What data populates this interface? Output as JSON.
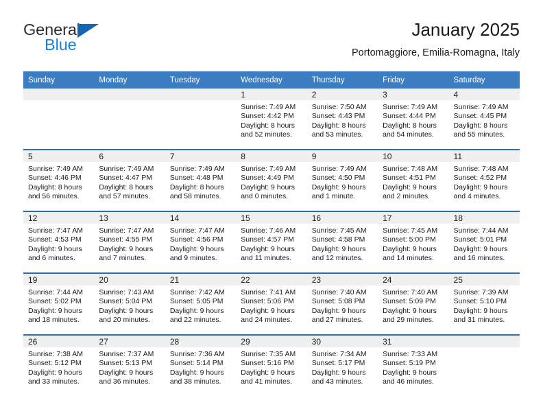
{
  "brand": {
    "line1": "General",
    "line2": "Blue",
    "triangle_color": "#1565b0",
    "blue_text_color": "#1a7fd4"
  },
  "header": {
    "title": "January 2025",
    "subtitle": "Portomaggiore, Emilia-Romagna, Italy"
  },
  "theme": {
    "header_row_bg": "#3b7dc0",
    "row_border": "#2f6cb0",
    "daynum_band_bg": "#efefef",
    "text": "#1a1a1a"
  },
  "calendar": {
    "weekday_headers": [
      "Sunday",
      "Monday",
      "Tuesday",
      "Wednesday",
      "Thursday",
      "Friday",
      "Saturday"
    ],
    "weeks": [
      [
        {
          "day": "",
          "sunrise": "",
          "sunset": "",
          "daylight1": "",
          "daylight2": ""
        },
        {
          "day": "",
          "sunrise": "",
          "sunset": "",
          "daylight1": "",
          "daylight2": ""
        },
        {
          "day": "",
          "sunrise": "",
          "sunset": "",
          "daylight1": "",
          "daylight2": ""
        },
        {
          "day": "1",
          "sunrise": "Sunrise: 7:49 AM",
          "sunset": "Sunset: 4:42 PM",
          "daylight1": "Daylight: 8 hours",
          "daylight2": "and 52 minutes."
        },
        {
          "day": "2",
          "sunrise": "Sunrise: 7:50 AM",
          "sunset": "Sunset: 4:43 PM",
          "daylight1": "Daylight: 8 hours",
          "daylight2": "and 53 minutes."
        },
        {
          "day": "3",
          "sunrise": "Sunrise: 7:49 AM",
          "sunset": "Sunset: 4:44 PM",
          "daylight1": "Daylight: 8 hours",
          "daylight2": "and 54 minutes."
        },
        {
          "day": "4",
          "sunrise": "Sunrise: 7:49 AM",
          "sunset": "Sunset: 4:45 PM",
          "daylight1": "Daylight: 8 hours",
          "daylight2": "and 55 minutes."
        }
      ],
      [
        {
          "day": "5",
          "sunrise": "Sunrise: 7:49 AM",
          "sunset": "Sunset: 4:46 PM",
          "daylight1": "Daylight: 8 hours",
          "daylight2": "and 56 minutes."
        },
        {
          "day": "6",
          "sunrise": "Sunrise: 7:49 AM",
          "sunset": "Sunset: 4:47 PM",
          "daylight1": "Daylight: 8 hours",
          "daylight2": "and 57 minutes."
        },
        {
          "day": "7",
          "sunrise": "Sunrise: 7:49 AM",
          "sunset": "Sunset: 4:48 PM",
          "daylight1": "Daylight: 8 hours",
          "daylight2": "and 58 minutes."
        },
        {
          "day": "8",
          "sunrise": "Sunrise: 7:49 AM",
          "sunset": "Sunset: 4:49 PM",
          "daylight1": "Daylight: 9 hours",
          "daylight2": "and 0 minutes."
        },
        {
          "day": "9",
          "sunrise": "Sunrise: 7:49 AM",
          "sunset": "Sunset: 4:50 PM",
          "daylight1": "Daylight: 9 hours",
          "daylight2": "and 1 minute."
        },
        {
          "day": "10",
          "sunrise": "Sunrise: 7:48 AM",
          "sunset": "Sunset: 4:51 PM",
          "daylight1": "Daylight: 9 hours",
          "daylight2": "and 2 minutes."
        },
        {
          "day": "11",
          "sunrise": "Sunrise: 7:48 AM",
          "sunset": "Sunset: 4:52 PM",
          "daylight1": "Daylight: 9 hours",
          "daylight2": "and 4 minutes."
        }
      ],
      [
        {
          "day": "12",
          "sunrise": "Sunrise: 7:47 AM",
          "sunset": "Sunset: 4:53 PM",
          "daylight1": "Daylight: 9 hours",
          "daylight2": "and 6 minutes."
        },
        {
          "day": "13",
          "sunrise": "Sunrise: 7:47 AM",
          "sunset": "Sunset: 4:55 PM",
          "daylight1": "Daylight: 9 hours",
          "daylight2": "and 7 minutes."
        },
        {
          "day": "14",
          "sunrise": "Sunrise: 7:47 AM",
          "sunset": "Sunset: 4:56 PM",
          "daylight1": "Daylight: 9 hours",
          "daylight2": "and 9 minutes."
        },
        {
          "day": "15",
          "sunrise": "Sunrise: 7:46 AM",
          "sunset": "Sunset: 4:57 PM",
          "daylight1": "Daylight: 9 hours",
          "daylight2": "and 11 minutes."
        },
        {
          "day": "16",
          "sunrise": "Sunrise: 7:45 AM",
          "sunset": "Sunset: 4:58 PM",
          "daylight1": "Daylight: 9 hours",
          "daylight2": "and 12 minutes."
        },
        {
          "day": "17",
          "sunrise": "Sunrise: 7:45 AM",
          "sunset": "Sunset: 5:00 PM",
          "daylight1": "Daylight: 9 hours",
          "daylight2": "and 14 minutes."
        },
        {
          "day": "18",
          "sunrise": "Sunrise: 7:44 AM",
          "sunset": "Sunset: 5:01 PM",
          "daylight1": "Daylight: 9 hours",
          "daylight2": "and 16 minutes."
        }
      ],
      [
        {
          "day": "19",
          "sunrise": "Sunrise: 7:44 AM",
          "sunset": "Sunset: 5:02 PM",
          "daylight1": "Daylight: 9 hours",
          "daylight2": "and 18 minutes."
        },
        {
          "day": "20",
          "sunrise": "Sunrise: 7:43 AM",
          "sunset": "Sunset: 5:04 PM",
          "daylight1": "Daylight: 9 hours",
          "daylight2": "and 20 minutes."
        },
        {
          "day": "21",
          "sunrise": "Sunrise: 7:42 AM",
          "sunset": "Sunset: 5:05 PM",
          "daylight1": "Daylight: 9 hours",
          "daylight2": "and 22 minutes."
        },
        {
          "day": "22",
          "sunrise": "Sunrise: 7:41 AM",
          "sunset": "Sunset: 5:06 PM",
          "daylight1": "Daylight: 9 hours",
          "daylight2": "and 24 minutes."
        },
        {
          "day": "23",
          "sunrise": "Sunrise: 7:40 AM",
          "sunset": "Sunset: 5:08 PM",
          "daylight1": "Daylight: 9 hours",
          "daylight2": "and 27 minutes."
        },
        {
          "day": "24",
          "sunrise": "Sunrise: 7:40 AM",
          "sunset": "Sunset: 5:09 PM",
          "daylight1": "Daylight: 9 hours",
          "daylight2": "and 29 minutes."
        },
        {
          "day": "25",
          "sunrise": "Sunrise: 7:39 AM",
          "sunset": "Sunset: 5:10 PM",
          "daylight1": "Daylight: 9 hours",
          "daylight2": "and 31 minutes."
        }
      ],
      [
        {
          "day": "26",
          "sunrise": "Sunrise: 7:38 AM",
          "sunset": "Sunset: 5:12 PM",
          "daylight1": "Daylight: 9 hours",
          "daylight2": "and 33 minutes."
        },
        {
          "day": "27",
          "sunrise": "Sunrise: 7:37 AM",
          "sunset": "Sunset: 5:13 PM",
          "daylight1": "Daylight: 9 hours",
          "daylight2": "and 36 minutes."
        },
        {
          "day": "28",
          "sunrise": "Sunrise: 7:36 AM",
          "sunset": "Sunset: 5:14 PM",
          "daylight1": "Daylight: 9 hours",
          "daylight2": "and 38 minutes."
        },
        {
          "day": "29",
          "sunrise": "Sunrise: 7:35 AM",
          "sunset": "Sunset: 5:16 PM",
          "daylight1": "Daylight: 9 hours",
          "daylight2": "and 41 minutes."
        },
        {
          "day": "30",
          "sunrise": "Sunrise: 7:34 AM",
          "sunset": "Sunset: 5:17 PM",
          "daylight1": "Daylight: 9 hours",
          "daylight2": "and 43 minutes."
        },
        {
          "day": "31",
          "sunrise": "Sunrise: 7:33 AM",
          "sunset": "Sunset: 5:19 PM",
          "daylight1": "Daylight: 9 hours",
          "daylight2": "and 46 minutes."
        },
        {
          "day": "",
          "sunrise": "",
          "sunset": "",
          "daylight1": "",
          "daylight2": ""
        }
      ]
    ]
  }
}
